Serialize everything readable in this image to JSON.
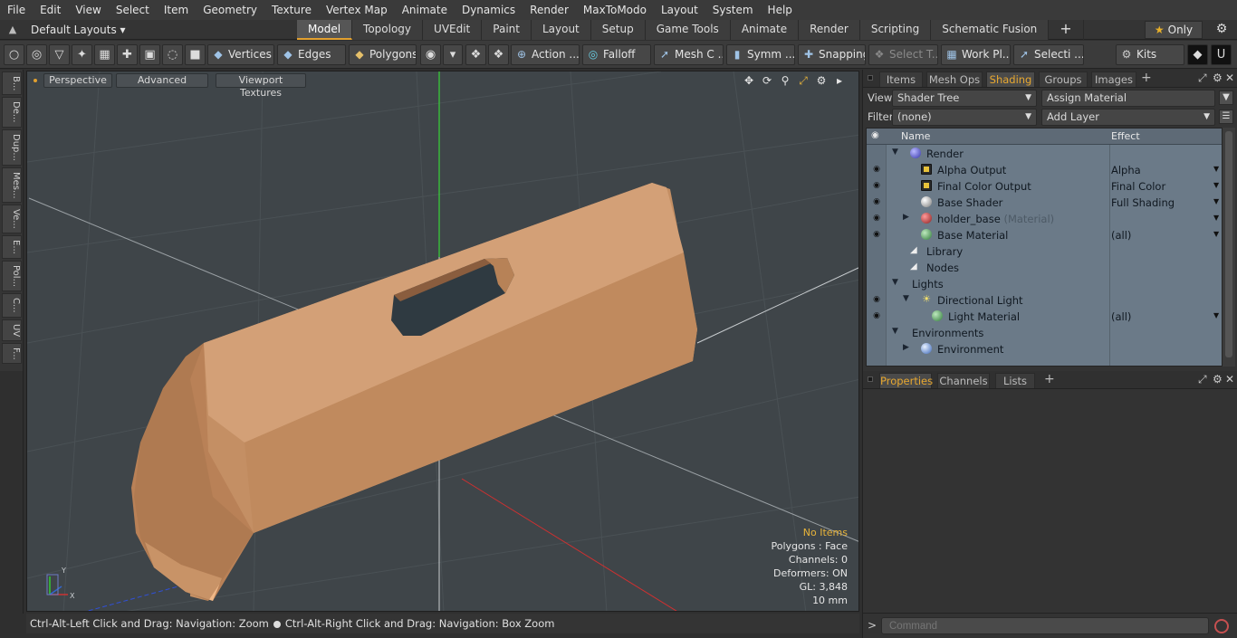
{
  "menu": [
    "File",
    "Edit",
    "View",
    "Select",
    "Item",
    "Geometry",
    "Texture",
    "Vertex Map",
    "Animate",
    "Dynamics",
    "Render",
    "MaxToModo",
    "Layout",
    "System",
    "Help"
  ],
  "layout_row": {
    "layouts_label": "Default Layouts",
    "tabs": [
      "Model",
      "Topology",
      "UVEdit",
      "Paint",
      "Layout",
      "Setup",
      "Game Tools",
      "Animate",
      "Render",
      "Scripting",
      "Schematic Fusion"
    ],
    "active_tab": "Model",
    "plus": "+",
    "only_label": "Only"
  },
  "toolbar": {
    "vertices": "Vertices",
    "edges": "Edges",
    "polygons": "Polygons",
    "action": "Action ...",
    "falloff": "Falloff",
    "mesh": "Mesh C ...",
    "symmetry": "Symm ...",
    "snapping": "Snapping",
    "select_t": "Select T...",
    "work_plane": "Work Pl...",
    "selection": "Selecti ...",
    "kits": "Kits"
  },
  "left_tabs": [
    "B...",
    "De...",
    "Dup...",
    "Mes...",
    "Ve...",
    "E...",
    "Pol...",
    "C...",
    "UV",
    "F..."
  ],
  "viewport": {
    "buttons": [
      "Perspective",
      "Advanced",
      "Viewport Textures"
    ],
    "info": [
      "No Items",
      "Polygons : Face",
      "Channels: 0",
      "Deformers: ON",
      "GL: 3,848",
      "10 mm"
    ],
    "axis_x": "X",
    "axis_y": "Y"
  },
  "status": {
    "left": "Ctrl-Alt-Left Click and Drag: Navigation: Zoom",
    "right": "Ctrl-Alt-Right Click and Drag: Navigation: Box Zoom"
  },
  "right_panel": {
    "top_tabs": [
      "Items",
      "Mesh Ops",
      "Shading",
      "Groups",
      "Images"
    ],
    "active_top_tab": "Shading",
    "view_label": "View",
    "view_value": "Shader Tree",
    "assign_material": "Assign Material",
    "filter_label": "Filter",
    "filter_value": "(none)",
    "add_layer": "Add Layer",
    "col_name": "Name",
    "col_effect": "Effect",
    "tree": [
      {
        "name": "Render",
        "sub": "",
        "effect": "",
        "eye": false
      },
      {
        "name": "Alpha Output",
        "sub": "",
        "effect": "Alpha",
        "eye": true
      },
      {
        "name": "Final Color Output",
        "sub": "",
        "effect": "Final Color",
        "eye": true
      },
      {
        "name": "Base Shader",
        "sub": "",
        "effect": "Full Shading",
        "eye": true
      },
      {
        "name": "holder_base",
        "sub": "(Material)",
        "effect": "",
        "eye": true
      },
      {
        "name": "Base Material",
        "sub": "",
        "effect": "(all)",
        "eye": true
      },
      {
        "name": "Library",
        "sub": "",
        "effect": "",
        "eye": false
      },
      {
        "name": "Nodes",
        "sub": "",
        "effect": "",
        "eye": false
      },
      {
        "name": "Lights",
        "sub": "",
        "effect": "",
        "eye": false
      },
      {
        "name": "Directional Light",
        "sub": "",
        "effect": "",
        "eye": true
      },
      {
        "name": "Light Material",
        "sub": "",
        "effect": "(all)",
        "eye": true
      },
      {
        "name": "Environments",
        "sub": "",
        "effect": "",
        "eye": false
      },
      {
        "name": "Environment",
        "sub": "",
        "effect": "",
        "eye": false
      }
    ],
    "bottom_tabs": [
      "Properties",
      "Channels",
      "Lists"
    ],
    "active_bottom_tab": "Properties",
    "command_placeholder": "Command"
  },
  "colors": {
    "accent": "#e2a02e",
    "viewport_bg": "#3f4549",
    "object": "#c8956a",
    "tree_bg": "#6b7a88"
  }
}
